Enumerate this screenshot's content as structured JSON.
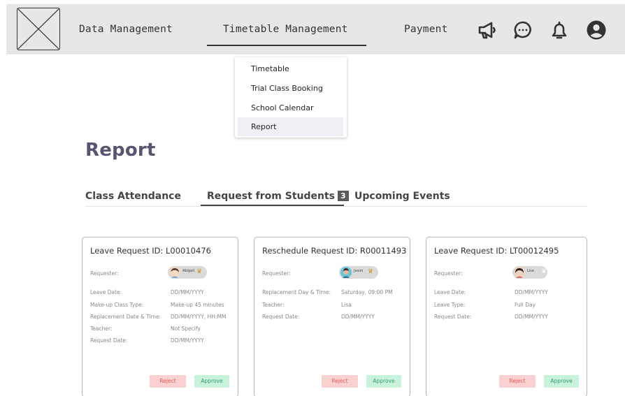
{
  "nav": {
    "items": [
      {
        "label": "Data Management"
      },
      {
        "label": "Timetable Management"
      },
      {
        "label": "Payment"
      }
    ],
    "icons": [
      "megaphone-icon",
      "chat-bubble-icon",
      "bell-icon",
      "user-account-icon"
    ]
  },
  "dropdown": {
    "items": [
      {
        "label": "Timetable"
      },
      {
        "label": "Trial Class Booking"
      },
      {
        "label": "School Calendar"
      },
      {
        "label": "Report"
      }
    ]
  },
  "page": {
    "title": "Report"
  },
  "tabs": [
    {
      "label": "Class Attendance"
    },
    {
      "label": "Request from Students",
      "badge": "3"
    },
    {
      "label": "Upcoming Events"
    }
  ],
  "cards": [
    {
      "title": "Leave Request ID: L00010476",
      "requester_label": "Requester:",
      "requester_name": "Abigail",
      "rows": [
        {
          "label": "Leave Date:",
          "value": "DD/MM/YYYY"
        },
        {
          "label": "Make-up Class Type:",
          "value": "Make-up 45 minutes"
        },
        {
          "label": "Replacement Date & Time:",
          "value": "DD/MM/YYYY, HH:MM"
        },
        {
          "label": "Teacher:",
          "value": "Not Specify"
        },
        {
          "label": "Request Date:",
          "value": "DD/MM/YYYY"
        }
      ],
      "reject": "Reject",
      "approve": "Approve"
    },
    {
      "title": "Reschedule Request ID: R00011493",
      "requester_label": "Requester:",
      "requester_name": "Jason",
      "rows": [
        {
          "label": "Replacement Day & Time:",
          "value": "Saturday, 09:00 PM"
        },
        {
          "label": "Teacher:",
          "value": "Lisa"
        },
        {
          "label": "Request Date:",
          "value": "DD/MM/YYYY"
        }
      ],
      "reject": "Reject",
      "approve": "Approve"
    },
    {
      "title": "Leave Request ID: LT00012495",
      "requester_label": "Requester:",
      "requester_name": "Lisa",
      "rows": [
        {
          "label": "Leave Date:",
          "value": "DD/MM/YYYY"
        },
        {
          "label": "Leave Type:",
          "value": "Full Day"
        },
        {
          "label": "Request Date:",
          "value": "DD/MM/YYYY"
        }
      ],
      "reject": "Reject",
      "approve": "Approve"
    }
  ],
  "colors": {
    "topbar": "#e7e7e7",
    "title": "#5b5470",
    "reject_bg": "#f9d1d1",
    "reject_text": "#e15a5a",
    "approve_bg": "#c9f2dd",
    "approve_text": "#2f9e63"
  }
}
